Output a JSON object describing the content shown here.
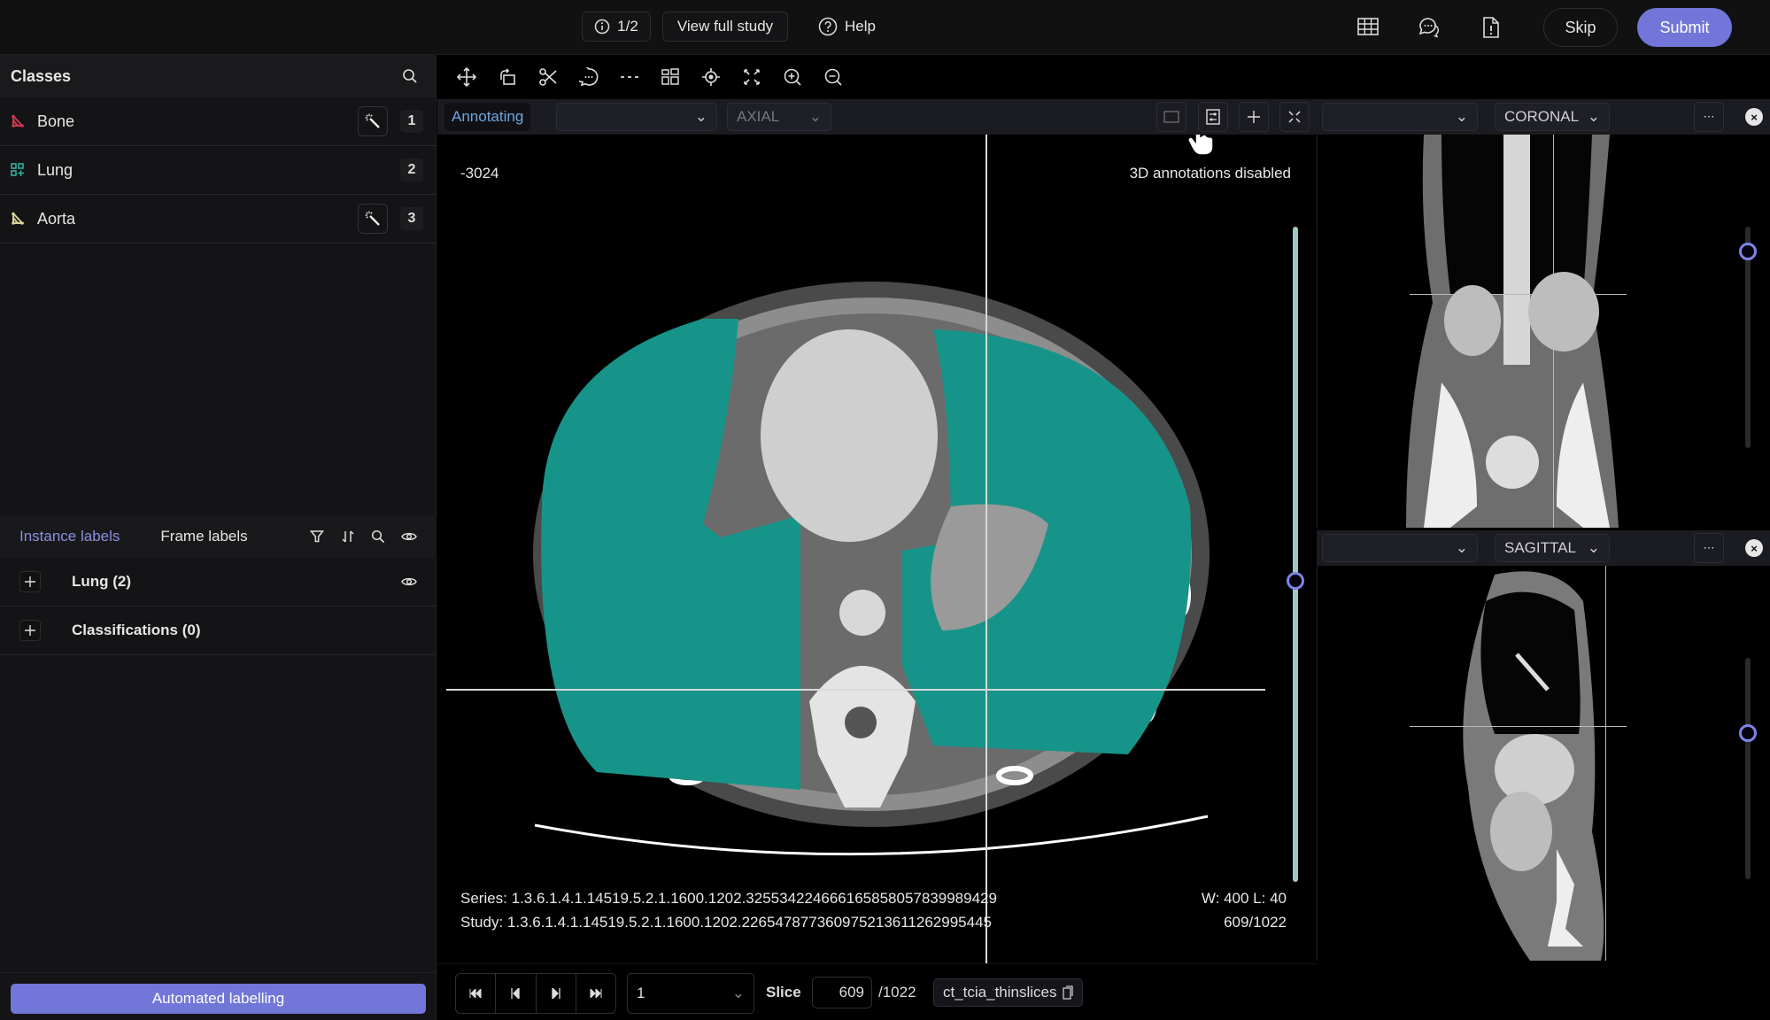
{
  "topbar": {
    "counter": "1/2",
    "view_full_study": "View full study",
    "help": "Help",
    "skip": "Skip",
    "submit": "Submit",
    "icons": [
      "table-icon",
      "comments-icon",
      "report-issue-icon"
    ]
  },
  "sidebar": {
    "classes_title": "Classes",
    "classes": [
      {
        "name": "Bone",
        "hotkey": "1",
        "color": "#d0364f",
        "icon": "polyline-icon",
        "has_wand": true
      },
      {
        "name": "Lung",
        "hotkey": "2",
        "color": "#2fb8a6",
        "icon": "segmentation-icon",
        "has_wand": false
      },
      {
        "name": "Aorta",
        "hotkey": "3",
        "color": "#d9d19a",
        "icon": "polyline-icon",
        "has_wand": true
      }
    ],
    "label_tabs": {
      "instance": "Instance labels",
      "frame": "Frame labels"
    },
    "label_groups": [
      {
        "name": "Lung (2)"
      },
      {
        "name": "Classifications (0)"
      }
    ],
    "automated_labelling": "Automated labelling"
  },
  "viewer": {
    "status_badge": "Annotating",
    "main_plane": "AXIAL",
    "window_value_top_left": "-3024",
    "annotations_notice": "3D annotations disabled",
    "series": "Series: 1.3.6.1.4.1.14519.5.2.1.1600.1202.325534224666165858057839989429",
    "study": "Study: 1.3.6.1.4.1.14519.5.2.1.1600.1202.226547877360975213611262995445",
    "window_level": "W: 400 L: 40",
    "slice_counter": "609/1022",
    "slice_position_fraction": 0.54,
    "segmentation_color": "#17948a",
    "coronal": {
      "plane": "CORONAL",
      "slider_fraction": 0.11
    },
    "sagittal": {
      "plane": "SAGITTAL",
      "slider_fraction": 0.34
    }
  },
  "bottom": {
    "frame_select": "1",
    "slice_label": "Slice",
    "slice_value": "609",
    "slice_total": "/1022",
    "dataset": "ct_tcia_thinslices"
  },
  "colors": {
    "accent": "#7176d8",
    "annotating": "#6fa6e0",
    "slider": "#9ec9c9"
  }
}
